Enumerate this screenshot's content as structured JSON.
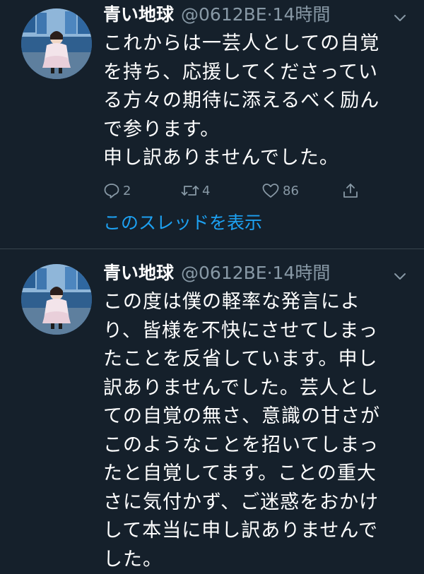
{
  "tweets": [
    {
      "name": "青い地球",
      "handle": "@0612BE",
      "separator": "·",
      "time": "14時間",
      "body": "これからは一芸人としての自覚\nを持ち、応援してくださってい\nる方々の期待に添えるべく励ん\nで参ります。\n申し訳ありませんでした。",
      "reply_count": "2",
      "retweet_count": "4",
      "like_count": "86",
      "thread_link": "このスレッドを表示"
    },
    {
      "name": "青い地球",
      "handle": "@0612BE",
      "separator": "·",
      "time": "14時間",
      "body": "この度は僕の軽率な発言によ\nり、皆様を不快にさせてしまっ\nたことを反省しています。申し\n訳ありませんでした。芸人とし\nての自覚の無さ、意識の甘さが\nこのようなことを招いてしまっ\nたと自覚してます。ことの重大\nさに気付かず、ご迷惑をおかけ\nして本当に申し訳ありませんで\nした。"
    }
  ],
  "colors": {
    "background": "#15202b",
    "text": "#ffffff",
    "secondary": "#8899a6",
    "link": "#1da1f2",
    "divider": "#38444d"
  },
  "icons": {
    "reply": "reply-icon",
    "retweet": "retweet-icon",
    "like": "like-icon",
    "share": "share-icon",
    "more": "chevron-down-icon"
  }
}
